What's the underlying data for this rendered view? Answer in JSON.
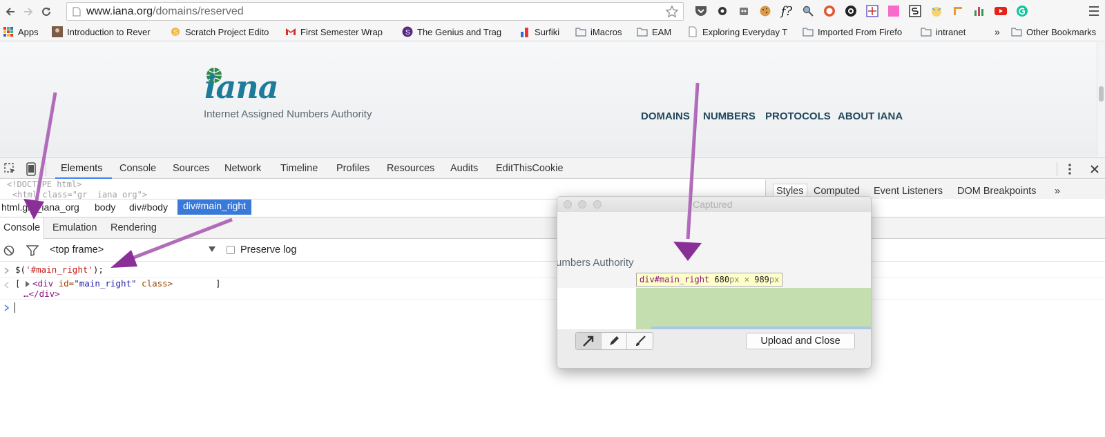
{
  "browser": {
    "url_host": "www.iana.org",
    "url_path": "/domains/reserved",
    "bookmarks": [
      {
        "label": "Apps"
      },
      {
        "label": "Introduction to Rever"
      },
      {
        "label": "Scratch Project Edito"
      },
      {
        "label": "First Semester Wrap"
      },
      {
        "label": "The Genius and Trag"
      },
      {
        "label": "Surfiki"
      },
      {
        "label": "iMacros"
      },
      {
        "label": "EAM"
      },
      {
        "label": "Exploring Everyday T"
      },
      {
        "label": "Imported From Firefo"
      },
      {
        "label": "intranet"
      },
      {
        "label": "Other Bookmarks"
      }
    ],
    "overflow_chevron": "»"
  },
  "page": {
    "logo_text": "iana",
    "tagline": "Internet Assigned Numbers Authority",
    "nav": [
      "DOMAINS",
      "NUMBERS",
      "PROTOCOLS",
      "ABOUT IANA"
    ]
  },
  "devtools": {
    "tabs": [
      "Elements",
      "Console",
      "Sources",
      "Network",
      "Timeline",
      "Profiles",
      "Resources",
      "Audits",
      "EditThisCookie"
    ],
    "active_tab": "Elements",
    "elements_lines": [
      "<!DOCTYPE html>",
      "<html class=\"gr__iana_org\">"
    ],
    "sidebar_tabs": [
      "Styles",
      "Computed",
      "Event Listeners",
      "DOM Breakpoints"
    ],
    "sidebar_more": "»",
    "breadcrumbs": [
      "html.gr__iana_org",
      "body",
      "div#body",
      "div#main_right"
    ],
    "drawer_tabs": [
      "Console",
      "Emulation",
      "Rendering"
    ],
    "frame_select": "<top frame>",
    "preserve_log": "Preserve log",
    "console": {
      "input_fn": "$(",
      "input_str": "'#main_right'",
      "input_end": ");",
      "result_open": "[",
      "result_tag_open": "<div",
      "result_attr_id": " id=",
      "result_id_val": "\"main_right\"",
      "result_attr_class": " class>",
      "result_close_bracket": "]",
      "result_ellipsis": "…</div>"
    }
  },
  "popup": {
    "title": "Captured",
    "image_text": "umbers Authority",
    "tooltip": {
      "selector": "div#main_right",
      "w": "680",
      "unit1": "px",
      "x": " × ",
      "h": "989",
      "unit2": "px"
    },
    "upload_label": "Upload and Close"
  },
  "colors": {
    "arrow": "#9b3aa6",
    "selection": "#3879d9",
    "tab_underline": "#3e82f7"
  }
}
